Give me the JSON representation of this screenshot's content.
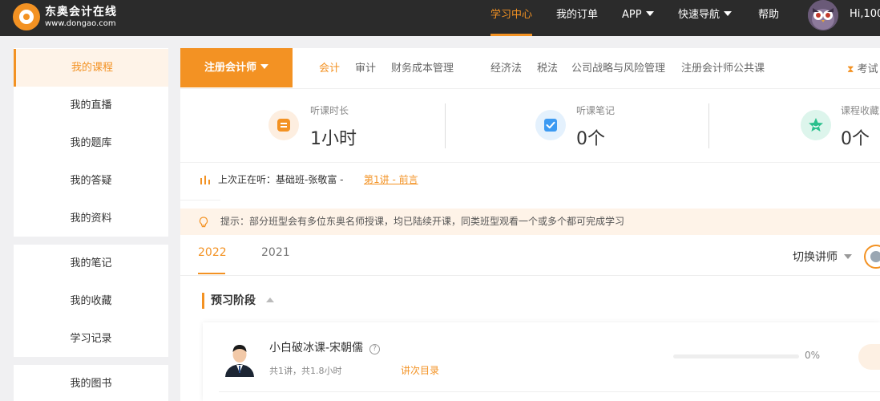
{
  "header": {
    "logo": {
      "name": "东奥会计在线",
      "url": "www.dongao.com"
    },
    "nav": [
      {
        "label": "学习中心",
        "active": true
      },
      {
        "label": "我的订单"
      },
      {
        "label": "APP",
        "dropdown": true
      },
      {
        "label": "快速导航",
        "dropdown": true
      },
      {
        "label": "帮助"
      }
    ],
    "user_greeting": "Hi,100"
  },
  "sidebar": {
    "groups": [
      [
        {
          "label": "我的课程",
          "active": true
        },
        {
          "label": "我的直播"
        },
        {
          "label": "我的题库"
        },
        {
          "label": "我的答疑"
        },
        {
          "label": "我的资料"
        }
      ],
      [
        {
          "label": "我的笔记"
        },
        {
          "label": "我的收藏"
        },
        {
          "label": "学习记录"
        }
      ],
      [
        {
          "label": "我的图书"
        }
      ]
    ]
  },
  "main": {
    "certificate_selector": "注册会计师",
    "subjects": [
      {
        "label": "会计",
        "active": true
      },
      {
        "label": "审计"
      },
      {
        "label": "财务成本管理"
      },
      {
        "label": "经济法"
      },
      {
        "label": "税法"
      },
      {
        "label": "公司战略与风险管理"
      },
      {
        "label": "注册会计师公共课"
      }
    ],
    "exam_link": "考试",
    "stats": [
      {
        "label": "听课时长",
        "value": "1小时",
        "icon": "listen-duration-icon",
        "color": "#f39223",
        "bg": "#fdeee0"
      },
      {
        "label": "听课笔记",
        "value": "0个",
        "icon": "note-check-icon",
        "color": "#3c9af2",
        "bg": "#e4f1fd"
      },
      {
        "label": "课程收藏",
        "value": "0个",
        "icon": "star-icon",
        "color": "#2bc08d",
        "bg": "#ddf5ec"
      }
    ],
    "last_played": {
      "prefix": "上次正在听：基础班-张敬富 -",
      "lesson": "第1讲 - 前言"
    },
    "tip": "提示：部分班型会有多位东奥名师授课，均已陆续开课，同类班型观看一个或多个都可完成学习",
    "year_tabs": [
      {
        "label": "2022",
        "active": true
      },
      {
        "label": "2021"
      }
    ],
    "switch_teacher": "切换讲师",
    "stage": "预习阶段",
    "courses": [
      {
        "title": "小白破冰课-宋朝儒",
        "meta": "共1讲，共1.8小时",
        "link": "讲次目录",
        "progress": 0,
        "progress_text": "0%"
      }
    ]
  },
  "colors": {
    "accent": "#f39223",
    "topbar": "#2b2b2b",
    "page_bg": "#f0f0f2"
  }
}
